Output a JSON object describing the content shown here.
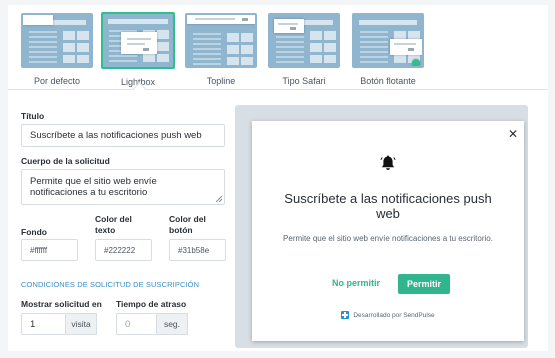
{
  "templates": [
    {
      "label": "Por defecto",
      "selected": false
    },
    {
      "label": "Lightbox",
      "selected": true
    },
    {
      "label": "Topline",
      "selected": false
    },
    {
      "label": "Tipo Safari",
      "selected": false
    },
    {
      "label": "Botón flotante",
      "selected": false
    }
  ],
  "form": {
    "title_label": "Título",
    "title_value": "Suscríbete a las notificaciones push web",
    "body_label": "Cuerpo de la solicitud",
    "body_value": "Permite que el sitio web envíe notificaciones a tu escritorio",
    "bg_label": "Fondo",
    "bg_value": "#ffffff",
    "text_color_label_1": "Color del",
    "text_color_label_2": "texto",
    "text_color_value": "#222222",
    "btn_color_label_1": "Color del",
    "btn_color_label_2": "botón",
    "btn_color_value": "#31b58e",
    "conditions_title": "CONDICIONES DE SOLICITUD DE SUSCRIPCIÓN",
    "show_label": "Mostrar solicitud en",
    "show_value": "1",
    "show_unit": "visita",
    "delay_label": "Tiempo de atraso",
    "delay_value": "0",
    "delay_unit": "seg."
  },
  "preview": {
    "close_symbol": "✕",
    "title": "Suscríbete a las notificaciones push web",
    "body": "Permite que el sitio web envíe notificaciones a tu escritorio.",
    "deny_label": "No permitir",
    "allow_label": "Permitir",
    "powered_by": "Desarrollado por SendPulse",
    "icons": {
      "bell": "bell-icon",
      "close": "close-icon",
      "brand": "sendpulse-logo-icon"
    }
  },
  "colors": {
    "accent": "#31b58e",
    "section_title": "#3a8ec6",
    "thumbnail": "#8fb5cf",
    "preview_backdrop": "#d7dee4"
  }
}
